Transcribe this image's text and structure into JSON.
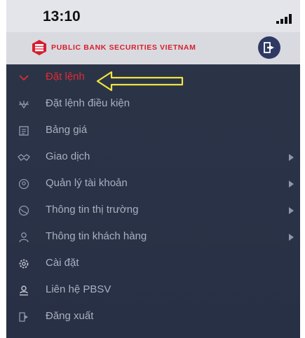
{
  "status_bar": {
    "time": "13:10",
    "signal_icon": "signal-bars-icon"
  },
  "header": {
    "logo_icon": "pbsv-logo-icon",
    "brand_text": "PUBLIC BANK SECURITIES VIETNAM",
    "logout_icon": "logout-icon"
  },
  "colors": {
    "menu_bg": "#2a3247",
    "menu_text": "#a9b0c0",
    "active": "#e02a35",
    "header_bg": "#d9dadf",
    "annotation": "#f2e43c"
  },
  "menu": {
    "items": [
      {
        "label": "Đặt lệnh",
        "icon": "chevron-down-icon",
        "active": true,
        "has_submenu": false
      },
      {
        "label": "Đặt lệnh điều kiện",
        "icon": "conditional-order-icon",
        "active": false,
        "has_submenu": false
      },
      {
        "label": "Bảng giá",
        "icon": "price-board-icon",
        "active": false,
        "has_submenu": false
      },
      {
        "label": "Giao dịch",
        "icon": "handshake-icon",
        "active": false,
        "has_submenu": true
      },
      {
        "label": "Quản lý tài khoản",
        "icon": "account-icon",
        "active": false,
        "has_submenu": true
      },
      {
        "label": "Thông tin thị trường",
        "icon": "globe-icon",
        "active": false,
        "has_submenu": true
      },
      {
        "label": "Thông tin khách hàng",
        "icon": "user-icon",
        "active": false,
        "has_submenu": true
      },
      {
        "label": "Cài đặt",
        "icon": "gear-icon",
        "active": false,
        "has_submenu": false
      },
      {
        "label": "Liên hệ PBSV",
        "icon": "contact-icon",
        "active": false,
        "has_submenu": false
      },
      {
        "label": "Đăng xuất",
        "icon": "logout-icon",
        "active": false,
        "has_submenu": false
      }
    ]
  },
  "annotation": {
    "icon": "arrow-left-annotation",
    "target": "Đặt lệnh"
  }
}
